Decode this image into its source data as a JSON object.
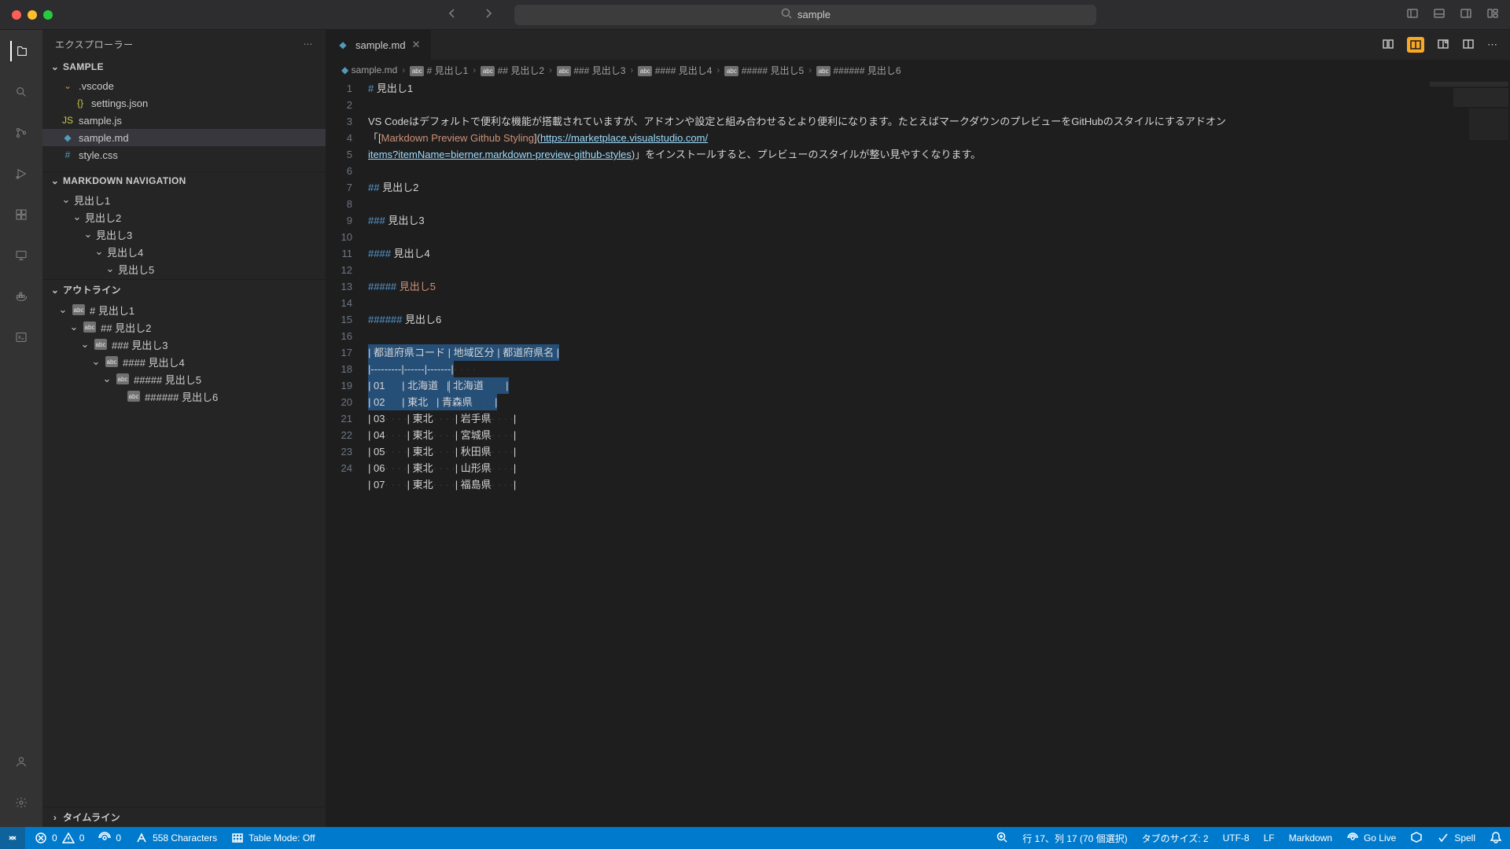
{
  "window": {
    "search_text": "sample"
  },
  "titlebar_icons": [
    "panel-left",
    "panel-bottom",
    "panel-right",
    "layout"
  ],
  "activity": {
    "items": [
      "files",
      "search",
      "source-control",
      "run",
      "extensions",
      "remote",
      "docker",
      "terminal"
    ],
    "bottom": [
      "account",
      "settings"
    ]
  },
  "sidebar": {
    "title": "エクスプローラー",
    "folder_header": "SAMPLE",
    "files": [
      {
        "name": ".vscode",
        "type": "folder",
        "indent": 0,
        "expanded": true
      },
      {
        "name": "settings.json",
        "type": "json",
        "indent": 1
      },
      {
        "name": "sample.js",
        "type": "js",
        "indent": 0
      },
      {
        "name": "sample.md",
        "type": "md",
        "indent": 0,
        "active": true
      },
      {
        "name": "style.css",
        "type": "css",
        "indent": 0
      }
    ],
    "md_nav": {
      "title": "MARKDOWN NAVIGATION",
      "items": [
        {
          "label": "見出し1",
          "indent": 0
        },
        {
          "label": "見出し2",
          "indent": 1
        },
        {
          "label": "見出し3",
          "indent": 2
        },
        {
          "label": "見出し4",
          "indent": 3
        },
        {
          "label": "見出し5",
          "indent": 4
        }
      ]
    },
    "outline": {
      "title": "アウトライン",
      "items": [
        {
          "label": "# 見出し1",
          "indent": 0
        },
        {
          "label": "## 見出し2",
          "indent": 1
        },
        {
          "label": "### 見出し3",
          "indent": 2
        },
        {
          "label": "#### 見出し4",
          "indent": 3
        },
        {
          "label": "##### 見出し5",
          "indent": 4
        },
        {
          "label": "###### 見出し6",
          "indent": 5
        }
      ]
    },
    "timeline": "タイムライン"
  },
  "tab": {
    "name": "sample.md"
  },
  "breadcrumbs": [
    {
      "icon": "md",
      "label": "sample.md"
    },
    {
      "icon": "sym",
      "label": "# 見出し1"
    },
    {
      "icon": "sym",
      "label": "## 見出し2"
    },
    {
      "icon": "sym",
      "label": "### 見出し3"
    },
    {
      "icon": "sym",
      "label": "#### 見出し4"
    },
    {
      "icon": "sym",
      "label": "##### 見出し5"
    },
    {
      "icon": "sym",
      "label": "###### 見出し6"
    }
  ],
  "editor": {
    "line_numbers": [
      "1",
      "2",
      "3",
      "",
      "",
      "4",
      "5",
      "6",
      "7",
      "8",
      "9",
      "10",
      "11",
      "12",
      "13",
      "14",
      "15",
      "16",
      "17",
      "18",
      "19",
      "20",
      "21",
      "22",
      "23",
      "24"
    ],
    "h1": {
      "mark": "#",
      "text": " 見出し1"
    },
    "para_pre": "VS Codeはデフォルトで便利な機能が搭載されていますが、アドオンや設定と組み合わせるとより便利になります。たとえばマークダウンのプレビューをGitHubのスタイルにするアドオン「[",
    "link_text": "Markdown Preview Github Styling",
    "para_mid": "](",
    "url_1": "https://marketplace.visualstudio.com/",
    "url_2": "items?itemName=bierner.markdown-preview-github-styles",
    "para_post": ")」をインストールすると、プレビューのスタイルが整い見やすくなります。",
    "h2": {
      "mark": "##",
      "text": " 見出し2"
    },
    "h3": {
      "mark": "###",
      "text": " 見出し3"
    },
    "h4": {
      "mark": "####",
      "text": " 見出し4"
    },
    "h5": {
      "mark": "#####",
      "text": " 見出し5"
    },
    "h6": {
      "mark": "######",
      "text": " 見出し6"
    },
    "table": {
      "header": "| 都道府県コード | 地域区分 | 都道府県名 |",
      "sep": "|---------|------|-------|",
      "rows": [
        {
          "c1": "01",
          "c2": "北海道",
          "c3": "北海道",
          "sel": true,
          "cursor": true
        },
        {
          "c1": "02",
          "c2": "東北",
          "c3": "青森県",
          "sel": true
        },
        {
          "c1": "03",
          "c2": "東北",
          "c3": "岩手県"
        },
        {
          "c1": "04",
          "c2": "東北",
          "c3": "宮城県"
        },
        {
          "c1": "05",
          "c2": "東北",
          "c3": "秋田県"
        },
        {
          "c1": "06",
          "c2": "東北",
          "c3": "山形県"
        },
        {
          "c1": "07",
          "c2": "東北",
          "c3": "福島県"
        }
      ]
    }
  },
  "status": {
    "errors": "0",
    "warnings": "0",
    "ports": "0",
    "chars": "558 Characters",
    "table_mode": "Table Mode: Off",
    "cursor": "行 17、列 17 (70 個選択)",
    "tab_size": "タブのサイズ: 2",
    "encoding": "UTF-8",
    "eol": "LF",
    "lang": "Markdown",
    "golive": "Go Live",
    "spell": "Spell"
  }
}
